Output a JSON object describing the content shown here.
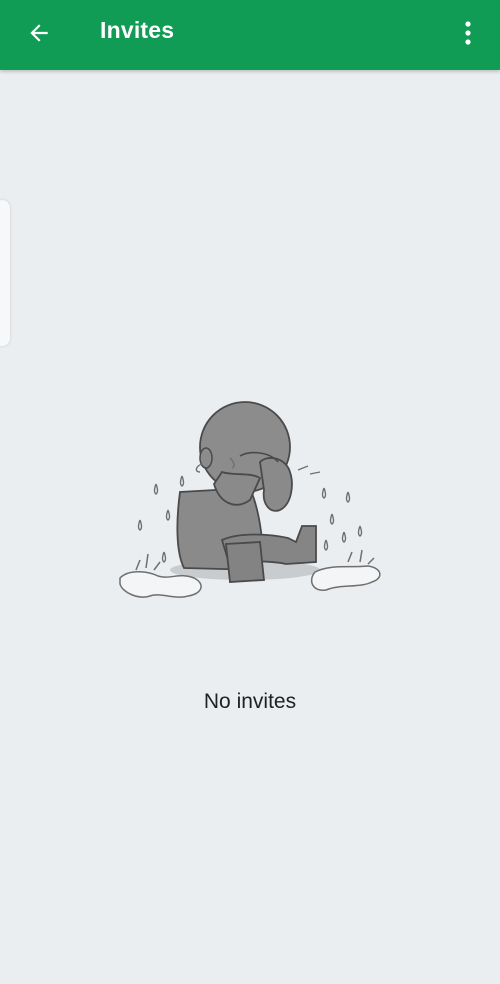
{
  "app_bar": {
    "title": "Invites",
    "back_icon": "arrow-left-icon",
    "menu_icon": "more-vert-icon",
    "background_color": "#119c55"
  },
  "empty_state": {
    "message": "No invites",
    "illustration": "crying-person-illustration"
  },
  "colors": {
    "page_background": "#ebeef0",
    "header_text": "#ffffff"
  }
}
